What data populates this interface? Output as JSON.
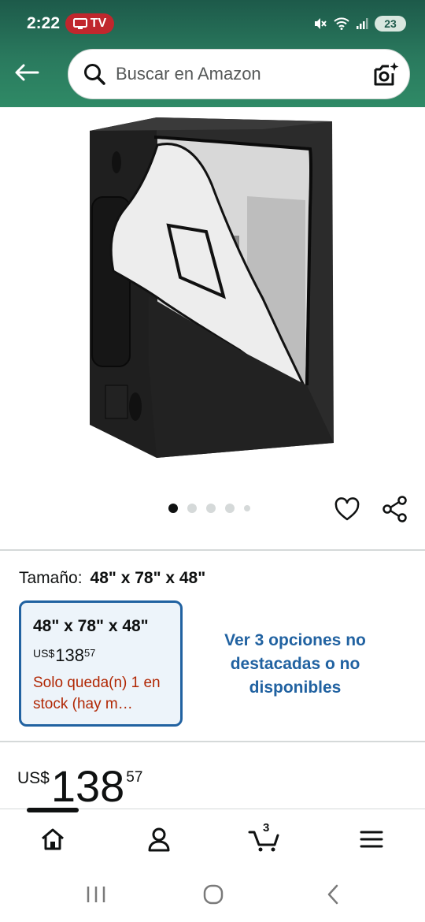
{
  "status_bar": {
    "time": "2:22",
    "tv_label": "TV",
    "battery": "23"
  },
  "search": {
    "placeholder": "Buscar en Amazon"
  },
  "carousel": {
    "total": 5,
    "active_index": 0
  },
  "size": {
    "label": "Tamaño:",
    "value": "48\" x 78\" x 48\""
  },
  "option": {
    "title": "48\" x 78\" x 48\"",
    "currency": "US$",
    "whole": "138",
    "cents": "57",
    "stock": "Solo queda(n) 1 en stock (hay m…"
  },
  "more_options": "Ver 3 opciones no destacadas o no disponibles",
  "price": {
    "currency": "US$",
    "whole": "138",
    "cents": "57"
  },
  "bottom_nav": {
    "cart_count": "3"
  },
  "colors": {
    "header": "#2a7a5e",
    "link": "#2162a1",
    "stock": "#b12704",
    "tv_pill": "#c0272d"
  },
  "icons": [
    "back-arrow-icon",
    "search-icon",
    "camera-icon",
    "heart-icon",
    "share-icon",
    "home-icon",
    "account-icon",
    "cart-icon",
    "menu-icon"
  ]
}
